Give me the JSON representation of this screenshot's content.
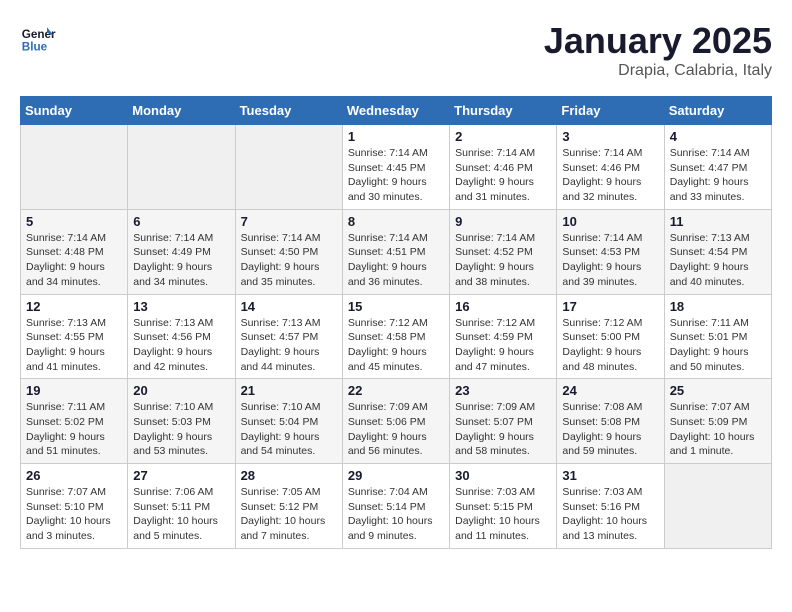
{
  "header": {
    "logo_line1": "General",
    "logo_line2": "Blue",
    "month_title": "January 2025",
    "location": "Drapia, Calabria, Italy"
  },
  "weekdays": [
    "Sunday",
    "Monday",
    "Tuesday",
    "Wednesday",
    "Thursday",
    "Friday",
    "Saturday"
  ],
  "weeks": [
    [
      {
        "day": "",
        "sunrise": "",
        "sunset": "",
        "daylight": "",
        "empty": true
      },
      {
        "day": "",
        "sunrise": "",
        "sunset": "",
        "daylight": "",
        "empty": true
      },
      {
        "day": "",
        "sunrise": "",
        "sunset": "",
        "daylight": "",
        "empty": true
      },
      {
        "day": "1",
        "sunrise": "Sunrise: 7:14 AM",
        "sunset": "Sunset: 4:45 PM",
        "daylight": "Daylight: 9 hours and 30 minutes."
      },
      {
        "day": "2",
        "sunrise": "Sunrise: 7:14 AM",
        "sunset": "Sunset: 4:46 PM",
        "daylight": "Daylight: 9 hours and 31 minutes."
      },
      {
        "day": "3",
        "sunrise": "Sunrise: 7:14 AM",
        "sunset": "Sunset: 4:46 PM",
        "daylight": "Daylight: 9 hours and 32 minutes."
      },
      {
        "day": "4",
        "sunrise": "Sunrise: 7:14 AM",
        "sunset": "Sunset: 4:47 PM",
        "daylight": "Daylight: 9 hours and 33 minutes."
      }
    ],
    [
      {
        "day": "5",
        "sunrise": "Sunrise: 7:14 AM",
        "sunset": "Sunset: 4:48 PM",
        "daylight": "Daylight: 9 hours and 34 minutes."
      },
      {
        "day": "6",
        "sunrise": "Sunrise: 7:14 AM",
        "sunset": "Sunset: 4:49 PM",
        "daylight": "Daylight: 9 hours and 34 minutes."
      },
      {
        "day": "7",
        "sunrise": "Sunrise: 7:14 AM",
        "sunset": "Sunset: 4:50 PM",
        "daylight": "Daylight: 9 hours and 35 minutes."
      },
      {
        "day": "8",
        "sunrise": "Sunrise: 7:14 AM",
        "sunset": "Sunset: 4:51 PM",
        "daylight": "Daylight: 9 hours and 36 minutes."
      },
      {
        "day": "9",
        "sunrise": "Sunrise: 7:14 AM",
        "sunset": "Sunset: 4:52 PM",
        "daylight": "Daylight: 9 hours and 38 minutes."
      },
      {
        "day": "10",
        "sunrise": "Sunrise: 7:14 AM",
        "sunset": "Sunset: 4:53 PM",
        "daylight": "Daylight: 9 hours and 39 minutes."
      },
      {
        "day": "11",
        "sunrise": "Sunrise: 7:13 AM",
        "sunset": "Sunset: 4:54 PM",
        "daylight": "Daylight: 9 hours and 40 minutes."
      }
    ],
    [
      {
        "day": "12",
        "sunrise": "Sunrise: 7:13 AM",
        "sunset": "Sunset: 4:55 PM",
        "daylight": "Daylight: 9 hours and 41 minutes."
      },
      {
        "day": "13",
        "sunrise": "Sunrise: 7:13 AM",
        "sunset": "Sunset: 4:56 PM",
        "daylight": "Daylight: 9 hours and 42 minutes."
      },
      {
        "day": "14",
        "sunrise": "Sunrise: 7:13 AM",
        "sunset": "Sunset: 4:57 PM",
        "daylight": "Daylight: 9 hours and 44 minutes."
      },
      {
        "day": "15",
        "sunrise": "Sunrise: 7:12 AM",
        "sunset": "Sunset: 4:58 PM",
        "daylight": "Daylight: 9 hours and 45 minutes."
      },
      {
        "day": "16",
        "sunrise": "Sunrise: 7:12 AM",
        "sunset": "Sunset: 4:59 PM",
        "daylight": "Daylight: 9 hours and 47 minutes."
      },
      {
        "day": "17",
        "sunrise": "Sunrise: 7:12 AM",
        "sunset": "Sunset: 5:00 PM",
        "daylight": "Daylight: 9 hours and 48 minutes."
      },
      {
        "day": "18",
        "sunrise": "Sunrise: 7:11 AM",
        "sunset": "Sunset: 5:01 PM",
        "daylight": "Daylight: 9 hours and 50 minutes."
      }
    ],
    [
      {
        "day": "19",
        "sunrise": "Sunrise: 7:11 AM",
        "sunset": "Sunset: 5:02 PM",
        "daylight": "Daylight: 9 hours and 51 minutes."
      },
      {
        "day": "20",
        "sunrise": "Sunrise: 7:10 AM",
        "sunset": "Sunset: 5:03 PM",
        "daylight": "Daylight: 9 hours and 53 minutes."
      },
      {
        "day": "21",
        "sunrise": "Sunrise: 7:10 AM",
        "sunset": "Sunset: 5:04 PM",
        "daylight": "Daylight: 9 hours and 54 minutes."
      },
      {
        "day": "22",
        "sunrise": "Sunrise: 7:09 AM",
        "sunset": "Sunset: 5:06 PM",
        "daylight": "Daylight: 9 hours and 56 minutes."
      },
      {
        "day": "23",
        "sunrise": "Sunrise: 7:09 AM",
        "sunset": "Sunset: 5:07 PM",
        "daylight": "Daylight: 9 hours and 58 minutes."
      },
      {
        "day": "24",
        "sunrise": "Sunrise: 7:08 AM",
        "sunset": "Sunset: 5:08 PM",
        "daylight": "Daylight: 9 hours and 59 minutes."
      },
      {
        "day": "25",
        "sunrise": "Sunrise: 7:07 AM",
        "sunset": "Sunset: 5:09 PM",
        "daylight": "Daylight: 10 hours and 1 minute."
      }
    ],
    [
      {
        "day": "26",
        "sunrise": "Sunrise: 7:07 AM",
        "sunset": "Sunset: 5:10 PM",
        "daylight": "Daylight: 10 hours and 3 minutes."
      },
      {
        "day": "27",
        "sunrise": "Sunrise: 7:06 AM",
        "sunset": "Sunset: 5:11 PM",
        "daylight": "Daylight: 10 hours and 5 minutes."
      },
      {
        "day": "28",
        "sunrise": "Sunrise: 7:05 AM",
        "sunset": "Sunset: 5:12 PM",
        "daylight": "Daylight: 10 hours and 7 minutes."
      },
      {
        "day": "29",
        "sunrise": "Sunrise: 7:04 AM",
        "sunset": "Sunset: 5:14 PM",
        "daylight": "Daylight: 10 hours and 9 minutes."
      },
      {
        "day": "30",
        "sunrise": "Sunrise: 7:03 AM",
        "sunset": "Sunset: 5:15 PM",
        "daylight": "Daylight: 10 hours and 11 minutes."
      },
      {
        "day": "31",
        "sunrise": "Sunrise: 7:03 AM",
        "sunset": "Sunset: 5:16 PM",
        "daylight": "Daylight: 10 hours and 13 minutes."
      },
      {
        "day": "",
        "sunrise": "",
        "sunset": "",
        "daylight": "",
        "empty": true
      }
    ]
  ]
}
